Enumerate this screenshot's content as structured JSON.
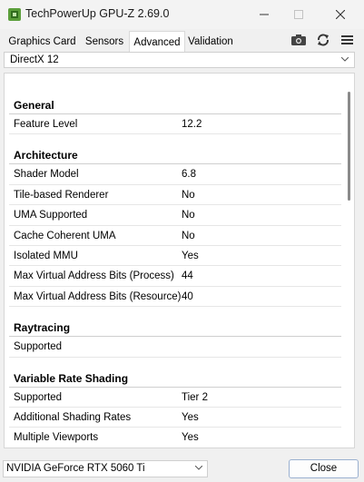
{
  "window": {
    "title": "TechPowerUp GPU-Z 2.69.0"
  },
  "tabs": [
    {
      "label": "Graphics Card"
    },
    {
      "label": "Sensors"
    },
    {
      "label": "Advanced",
      "active": true
    },
    {
      "label": "Validation"
    }
  ],
  "toolbar": {
    "icons": [
      "camera-icon",
      "refresh-icon",
      "menu-icon"
    ]
  },
  "api_select": {
    "value": "DirectX 12"
  },
  "sections": [
    {
      "title": "General",
      "rows": [
        {
          "key": "Feature Level",
          "value": "12.2"
        }
      ]
    },
    {
      "title": "Architecture",
      "rows": [
        {
          "key": "Shader Model",
          "value": "6.8"
        },
        {
          "key": "Tile-based Renderer",
          "value": "No"
        },
        {
          "key": "UMA Supported",
          "value": "No"
        },
        {
          "key": "Cache Coherent UMA",
          "value": "No"
        },
        {
          "key": "Isolated MMU",
          "value": "Yes"
        },
        {
          "key": "Max Virtual Address Bits (Process)",
          "value": "44"
        },
        {
          "key": "Max Virtual Address Bits (Resource)",
          "value": "40"
        }
      ]
    },
    {
      "title": "Raytracing",
      "rows": [
        {
          "key": "Supported",
          "value": ""
        }
      ]
    },
    {
      "title": "Variable Rate Shading",
      "rows": [
        {
          "key": "Supported",
          "value": "Tier 2"
        },
        {
          "key": "Additional Shading Rates",
          "value": "Yes"
        },
        {
          "key": "Multiple Viewports",
          "value": "Yes"
        }
      ]
    }
  ],
  "gpu_select": {
    "value": "NVIDIA GeForce RTX 5060 Ti"
  },
  "close_button": {
    "label": "Close"
  },
  "colors": {
    "accent": "#5a9e3a",
    "button_border": "#9ab0d0"
  }
}
